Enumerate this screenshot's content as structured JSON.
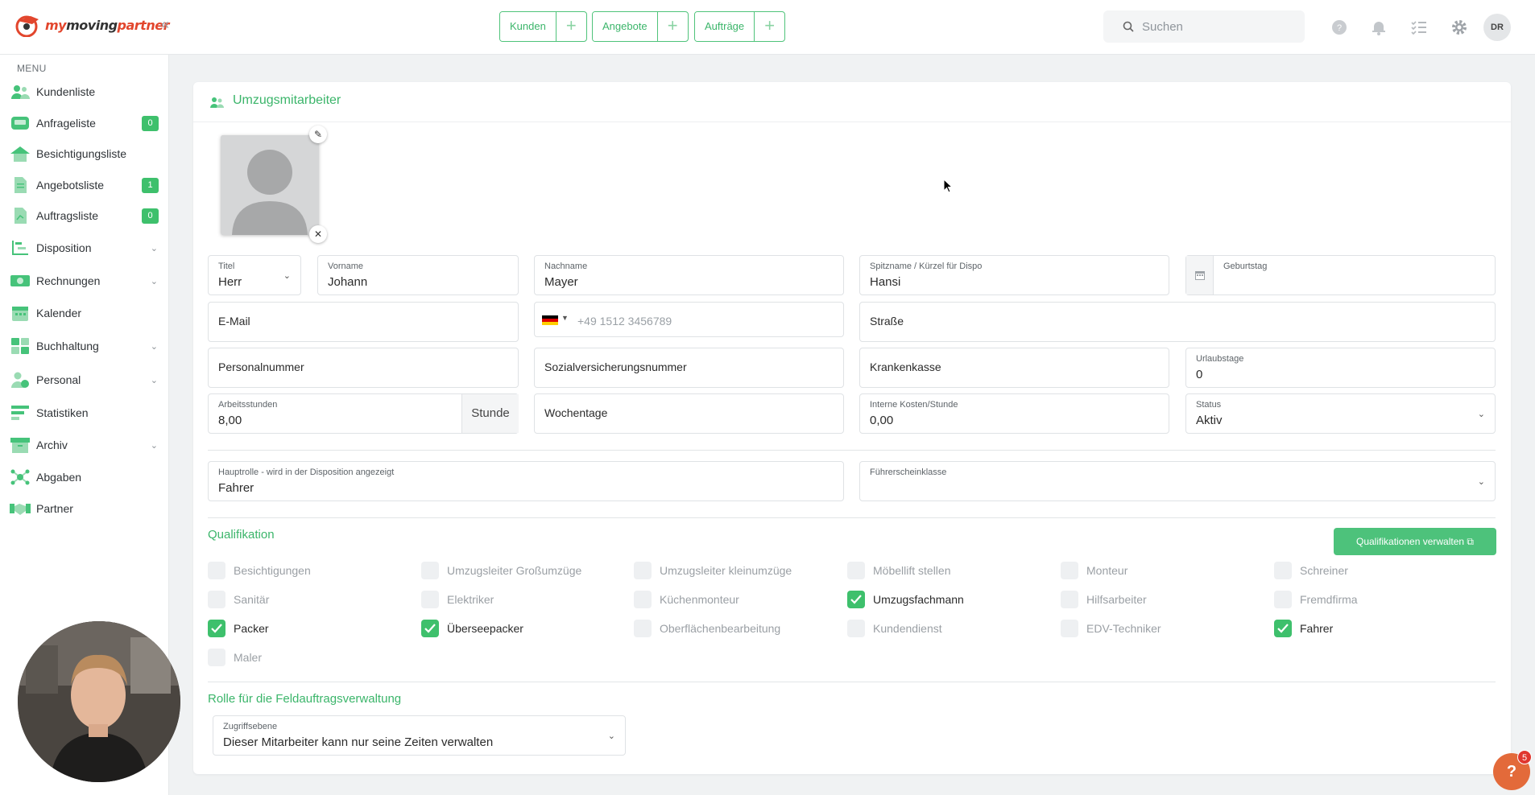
{
  "header": {
    "logo_a": "my",
    "logo_b": "moving",
    "logo_c": "partner",
    "quick_actions": [
      {
        "label": "Kunden"
      },
      {
        "label": "Angebote"
      },
      {
        "label": "Aufträge"
      }
    ],
    "search_placeholder": "Suchen",
    "user_initials": "DR"
  },
  "sidebar": {
    "menu_title": "MENU",
    "items": [
      {
        "label": "Kundenliste",
        "icon": "customers-icon"
      },
      {
        "label": "Anfrageliste",
        "icon": "inbox-icon",
        "badge": "0"
      },
      {
        "label": "Besichtigungsliste",
        "icon": "house-icon"
      },
      {
        "label": "Angebotsliste",
        "icon": "document-icon",
        "badge": "1"
      },
      {
        "label": "Auftragsliste",
        "icon": "document-icon",
        "badge": "0"
      },
      {
        "label": "Disposition",
        "icon": "gantt-icon"
      },
      {
        "label": "Rechnungen",
        "icon": "money-icon"
      },
      {
        "label": "Kalender",
        "icon": "calendar-icon"
      },
      {
        "label": "Buchhaltung",
        "icon": "grid-icon"
      },
      {
        "label": "Personal",
        "icon": "person-icon"
      },
      {
        "label": "Statistiken",
        "icon": "stats-icon"
      },
      {
        "label": "Archiv",
        "icon": "archive-icon"
      },
      {
        "label": "Abgaben",
        "icon": "network-icon"
      },
      {
        "label": "Partner",
        "icon": "handshake-icon"
      }
    ]
  },
  "form": {
    "title": "Umzugsmitarbeiter",
    "titel": {
      "label": "Titel",
      "value": "Herr"
    },
    "vorname": {
      "label": "Vorname",
      "value": "Johann"
    },
    "nachname": {
      "label": "Nachname",
      "value": "Mayer"
    },
    "spitzname": {
      "label": "Spitzname / Kürzel für Dispo",
      "value": "Hansi"
    },
    "geburtstag": {
      "label": "Geburtstag"
    },
    "email": {
      "placeholder": "E-Mail"
    },
    "phone": {
      "placeholder": "+49 1512 3456789"
    },
    "strasse": {
      "placeholder": "Straße"
    },
    "personalnummer": {
      "placeholder": "Personalnummer"
    },
    "svnummer": {
      "placeholder": "Sozialversicherungsnummer"
    },
    "krankenkasse": {
      "placeholder": "Krankenkasse"
    },
    "urlaubstage": {
      "label": "Urlaubstage",
      "value": "0"
    },
    "arbeitsstunden": {
      "label": "Arbeitsstunden",
      "value": "8,00",
      "unit": "Stunde"
    },
    "wochentage": {
      "placeholder": "Wochentage"
    },
    "kosten": {
      "label": "Interne Kosten/Stunde",
      "value": "0,00"
    },
    "status": {
      "label": "Status",
      "value": "Aktiv"
    },
    "hauptrolle": {
      "label": "Hauptrolle - wird in der Disposition angezeigt",
      "value": "Fahrer"
    },
    "fuehrerschein": {
      "label": "Führerscheinklasse"
    }
  },
  "qualifikation": {
    "title": "Qualifikation",
    "manage_button": "Qualifikationen verwalten",
    "items": [
      {
        "label": "Besichtigungen",
        "checked": false
      },
      {
        "label": "Umzugsleiter Großumzüge",
        "checked": false
      },
      {
        "label": "Umzugsleiter kleinumzüge",
        "checked": false
      },
      {
        "label": "Möbellift stellen",
        "checked": false
      },
      {
        "label": "Monteur",
        "checked": false
      },
      {
        "label": "Schreiner",
        "checked": false
      },
      {
        "label": "Sanitär",
        "checked": false
      },
      {
        "label": "Elektriker",
        "checked": false
      },
      {
        "label": "Küchenmonteur",
        "checked": false
      },
      {
        "label": "Umzugsfachmann",
        "checked": true
      },
      {
        "label": "Hilfsarbeiter",
        "checked": false
      },
      {
        "label": "Fremdfirma",
        "checked": false
      },
      {
        "label": "Packer",
        "checked": true
      },
      {
        "label": "Überseepacker",
        "checked": true
      },
      {
        "label": "Oberflächenbearbeitung",
        "checked": false
      },
      {
        "label": "Kundendienst",
        "checked": false
      },
      {
        "label": "EDV-Techniker",
        "checked": false
      },
      {
        "label": "Fahrer",
        "checked": true
      },
      {
        "label": "Maler",
        "checked": false
      }
    ]
  },
  "rolle": {
    "title": "Rolle für die Feldauftragsverwaltung",
    "zugriff_label": "Zugriffsebene",
    "zugriff_value": "Dieser Mitarbeiter kann nur seine Zeiten verwalten"
  },
  "help": {
    "label": "?",
    "badge": "5"
  },
  "colors": {
    "accent": "#3ec06c",
    "brand": "#e2462d"
  }
}
